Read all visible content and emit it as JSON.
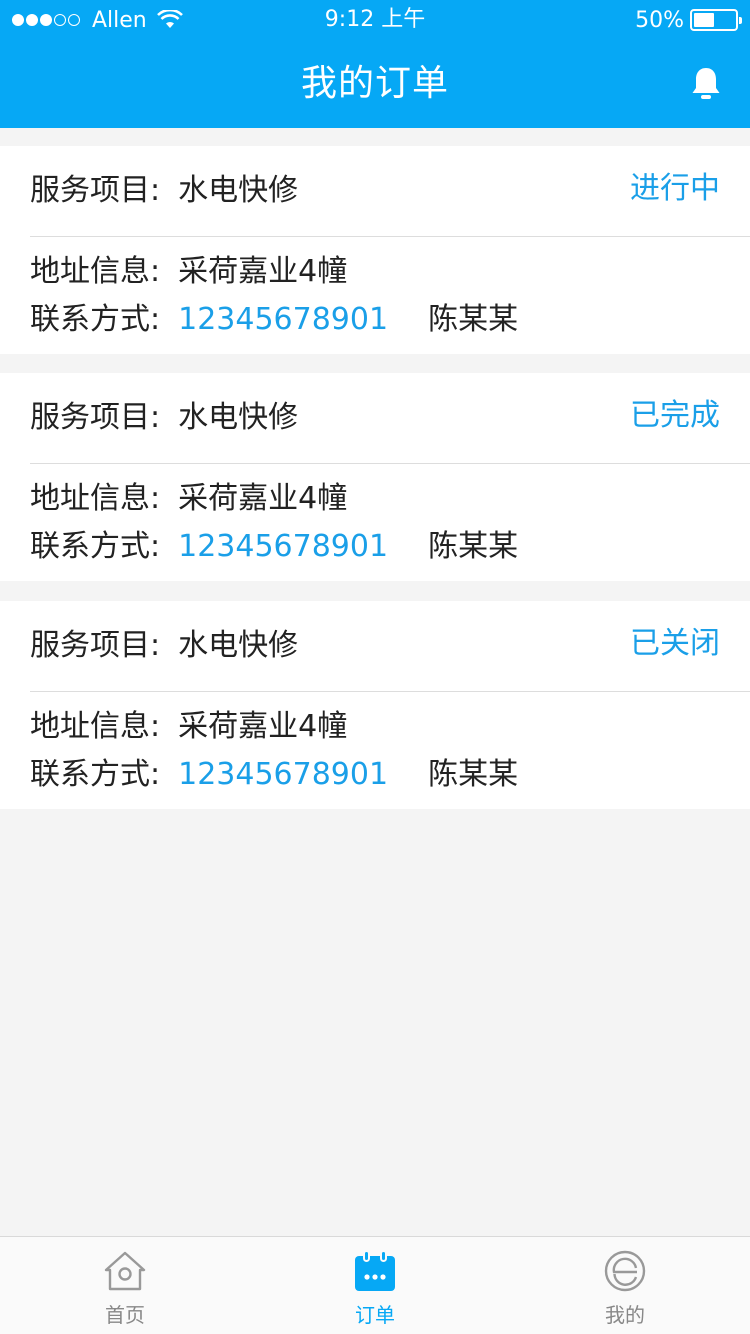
{
  "status_bar": {
    "carrier": "Allen",
    "time": "9:12 上午",
    "battery": "50%"
  },
  "header": {
    "title": "我的订单"
  },
  "labels": {
    "service": "服务项目:",
    "address": "地址信息:",
    "contact": "联系方式:"
  },
  "orders": [
    {
      "service": "水电快修",
      "status": "进行中",
      "address": "采荷嘉业4幢",
      "phone": "12345678901",
      "name": "陈某某"
    },
    {
      "service": "水电快修",
      "status": "已完成",
      "address": "采荷嘉业4幢",
      "phone": "12345678901",
      "name": "陈某某"
    },
    {
      "service": "水电快修",
      "status": "已关闭",
      "address": "采荷嘉业4幢",
      "phone": "12345678901",
      "name": "陈某某"
    }
  ],
  "tab_bar": {
    "tabs": [
      {
        "label": "首页",
        "icon": "home-icon"
      },
      {
        "label": "订单",
        "icon": "calendar-icon"
      },
      {
        "label": "我的",
        "icon": "profile-e-icon"
      }
    ],
    "active": "订单"
  },
  "colors": {
    "primary": "#06a8f5",
    "status_text": "#1a9fe8",
    "background": "#f4f4f4"
  }
}
